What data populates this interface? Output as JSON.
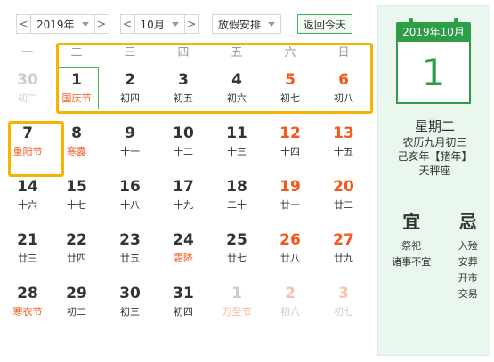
{
  "toolbar": {
    "prev_year": "<",
    "year": "2019年",
    "next_year": ">",
    "prev_month": "<",
    "month": "10月",
    "next_month": ">",
    "holiday": "放假安排",
    "today": "返回今天"
  },
  "weekdays": [
    "一",
    "二",
    "三",
    "四",
    "五",
    "六",
    "日"
  ],
  "weeks": [
    [
      {
        "day": "30",
        "lunar": "初二",
        "state": "dim"
      },
      {
        "day": "1",
        "lunar": "国庆节",
        "state": "today",
        "fest": true
      },
      {
        "day": "2",
        "lunar": "初四"
      },
      {
        "day": "3",
        "lunar": "初五"
      },
      {
        "day": "4",
        "lunar": "初六"
      },
      {
        "day": "5",
        "lunar": "初七",
        "state": "red"
      },
      {
        "day": "6",
        "lunar": "初八",
        "state": "red"
      }
    ],
    [
      {
        "day": "7",
        "lunar": "重阳节",
        "fest": true
      },
      {
        "day": "8",
        "lunar": "寒露",
        "fest": true
      },
      {
        "day": "9",
        "lunar": "十一"
      },
      {
        "day": "10",
        "lunar": "十二"
      },
      {
        "day": "11",
        "lunar": "十三"
      },
      {
        "day": "12",
        "lunar": "十四",
        "state": "red"
      },
      {
        "day": "13",
        "lunar": "十五",
        "state": "red"
      }
    ],
    [
      {
        "day": "14",
        "lunar": "十六"
      },
      {
        "day": "15",
        "lunar": "十七"
      },
      {
        "day": "16",
        "lunar": "十八"
      },
      {
        "day": "17",
        "lunar": "十九"
      },
      {
        "day": "18",
        "lunar": "二十"
      },
      {
        "day": "19",
        "lunar": "廿一",
        "state": "red"
      },
      {
        "day": "20",
        "lunar": "廿二",
        "state": "red"
      }
    ],
    [
      {
        "day": "21",
        "lunar": "廿三"
      },
      {
        "day": "22",
        "lunar": "廿四"
      },
      {
        "day": "23",
        "lunar": "廿五"
      },
      {
        "day": "24",
        "lunar": "霜降",
        "fest": true
      },
      {
        "day": "25",
        "lunar": "廿七"
      },
      {
        "day": "26",
        "lunar": "廿八",
        "state": "red"
      },
      {
        "day": "27",
        "lunar": "廿九",
        "state": "red"
      }
    ],
    [
      {
        "day": "28",
        "lunar": "寒衣节",
        "fest": true
      },
      {
        "day": "29",
        "lunar": "初二"
      },
      {
        "day": "30",
        "lunar": "初三"
      },
      {
        "day": "31",
        "lunar": "初四"
      },
      {
        "day": "1",
        "lunar": "万圣节",
        "state": "dim",
        "fest": true
      },
      {
        "day": "2",
        "lunar": "初六",
        "state": "dimred"
      },
      {
        "day": "3",
        "lunar": "初七",
        "state": "dimred"
      }
    ]
  ],
  "panel": {
    "header": "2019年10月",
    "day": "1",
    "weekday": "星期二",
    "lunar": "农历九月初三",
    "ganzhi": "己亥年【猪年】",
    "star": "天秤座",
    "yi_title": "宜",
    "yi": [
      "祭祀",
      "诸事不宜"
    ],
    "ji_title": "忌",
    "ji": [
      "入殓",
      "安葬",
      "开市",
      "交易"
    ]
  },
  "colors": {
    "accent": "#2d9d48",
    "holiday": "#f5581d",
    "highlight": "#f5b400"
  }
}
